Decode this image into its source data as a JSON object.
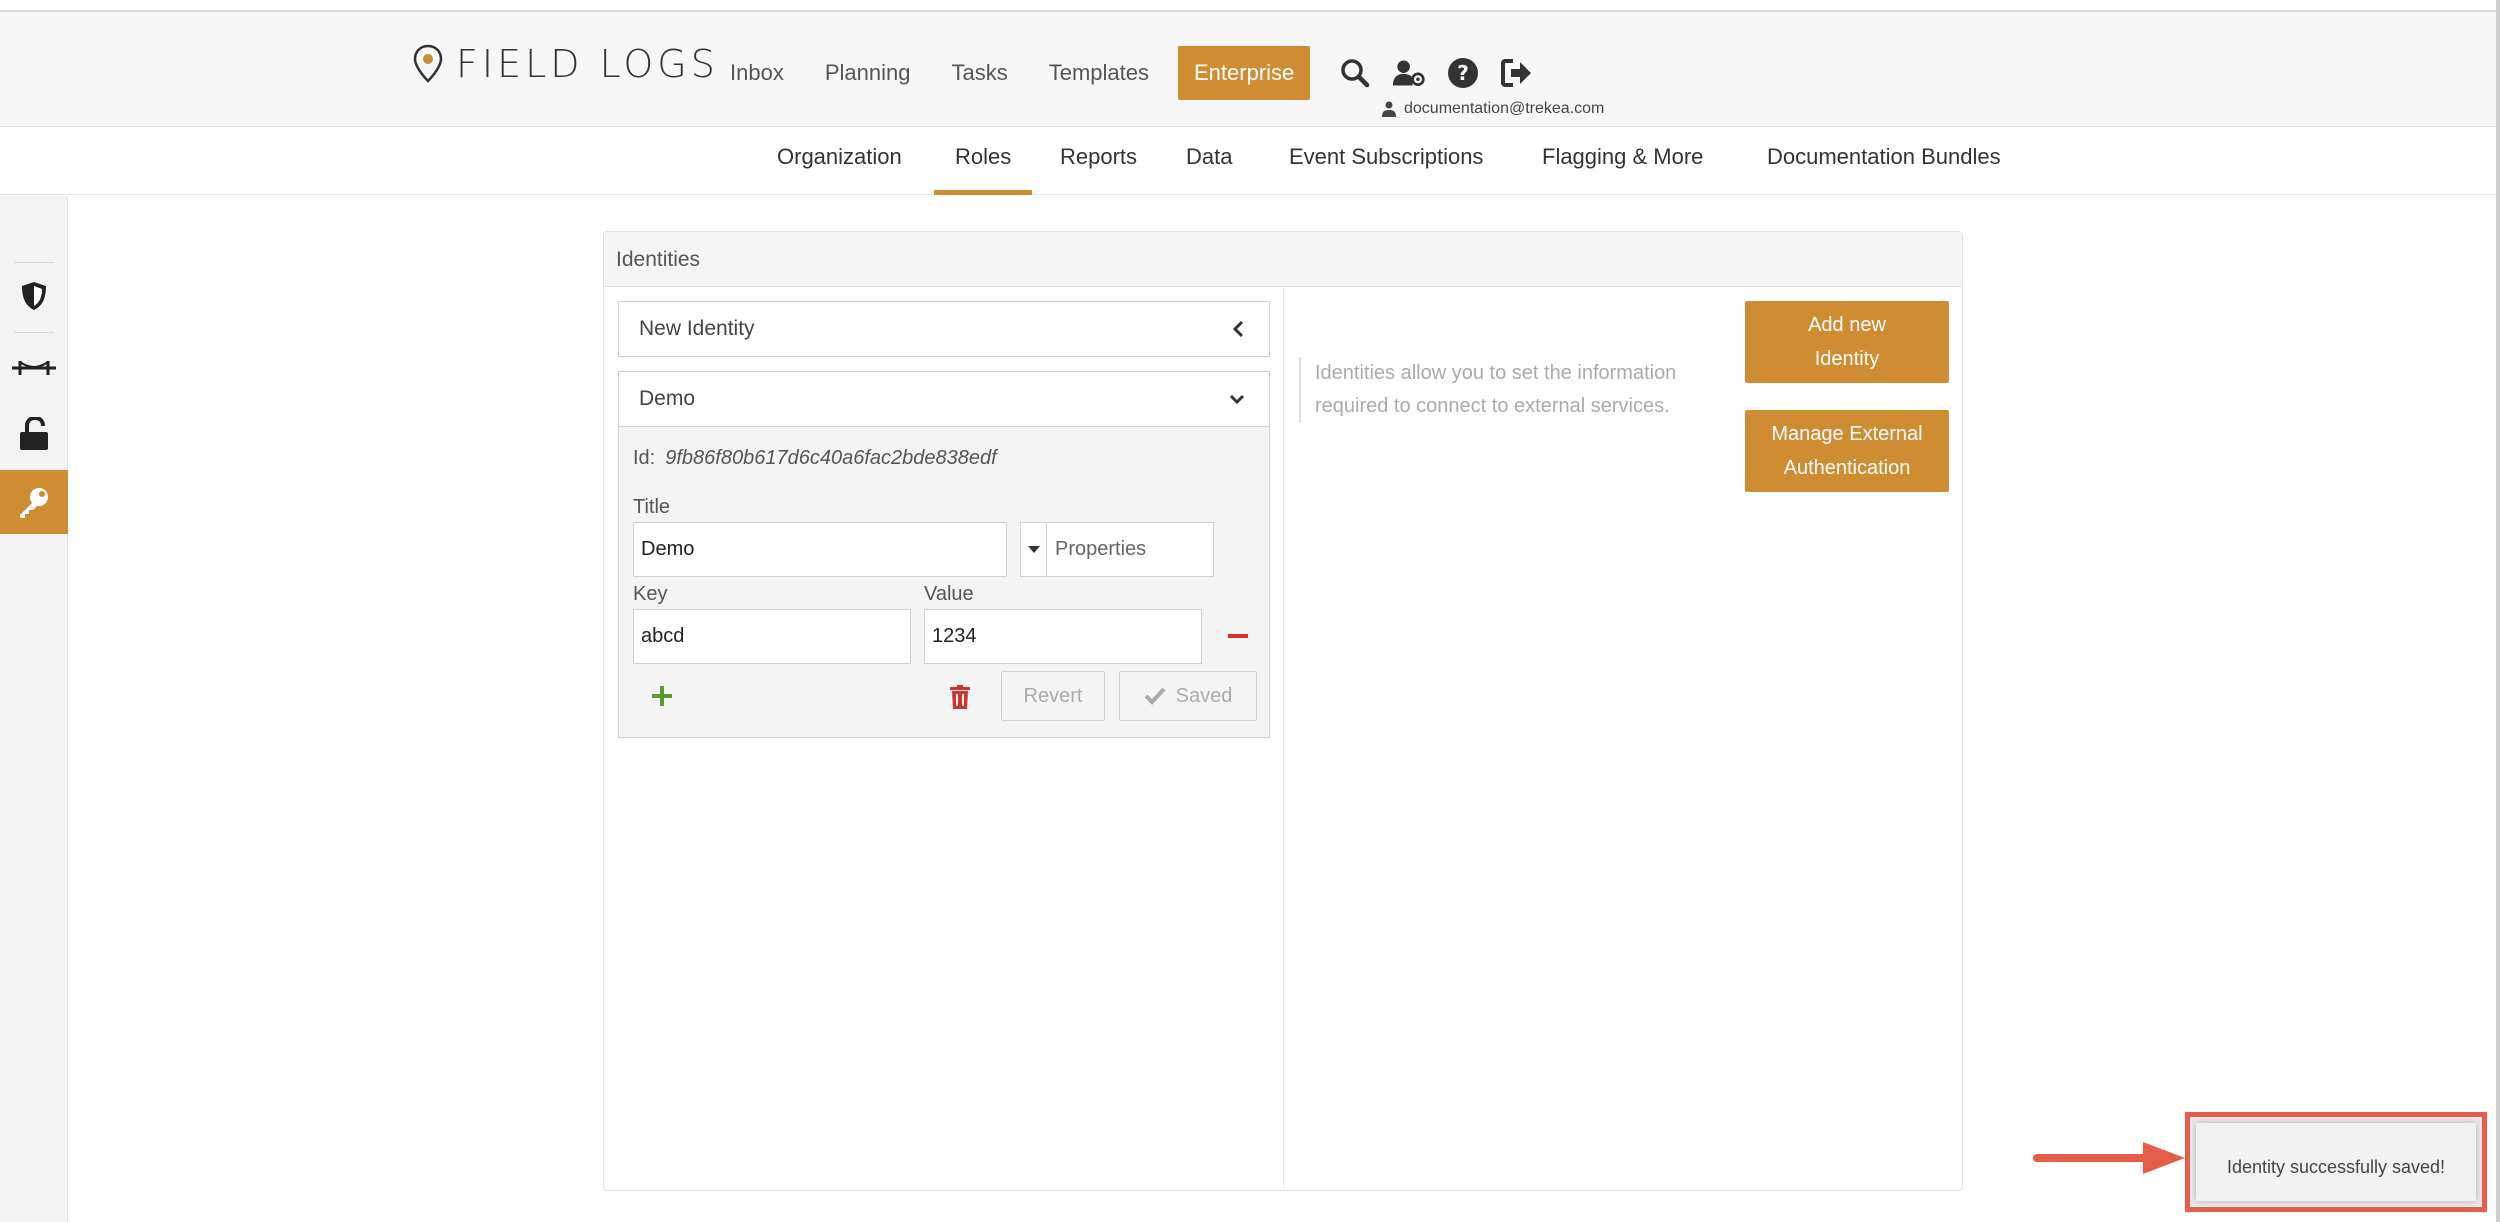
{
  "header": {
    "logo_text": "FIELD LOGS",
    "nav": [
      "Inbox",
      "Planning",
      "Tasks",
      "Templates",
      "Enterprise"
    ],
    "active_nav": "Enterprise",
    "user_email": "documentation@trekea.com",
    "icons": [
      "search-icon",
      "user-settings-icon",
      "help-icon",
      "logout-icon"
    ]
  },
  "subnav": {
    "items": [
      "Organization",
      "Roles",
      "Reports",
      "Data",
      "Event Subscriptions",
      "Flagging & More",
      "Documentation Bundles"
    ],
    "active": "Roles"
  },
  "rail": {
    "icons": [
      "shield-icon",
      "bridge-icon",
      "unlock-icon",
      "key-icon"
    ],
    "active": "key-icon"
  },
  "panel": {
    "title": "Identities",
    "new_identity_label": "New Identity",
    "identity": {
      "name": "Demo",
      "id_label": "Id:",
      "id_value": "9fb86f80b617d6c40a6fac2bde838edf",
      "title_label": "Title",
      "title_value": "Demo",
      "type_select": "Properties",
      "key_label": "Key",
      "value_label": "Value",
      "key_value": "abcd",
      "value_value": "1234",
      "revert_label": "Revert",
      "saved_label": "Saved"
    },
    "help_text": "Identities allow you to set the information required to connect to external services.",
    "add_button": "Add new Identity",
    "manage_button": "Manage External Authentication"
  },
  "toast": {
    "message": "Identity successfully saved!"
  },
  "colors": {
    "accent": "#d08c33",
    "danger": "#d0342c",
    "success": "#5a9a2e",
    "annotation": "#e35d4a"
  }
}
